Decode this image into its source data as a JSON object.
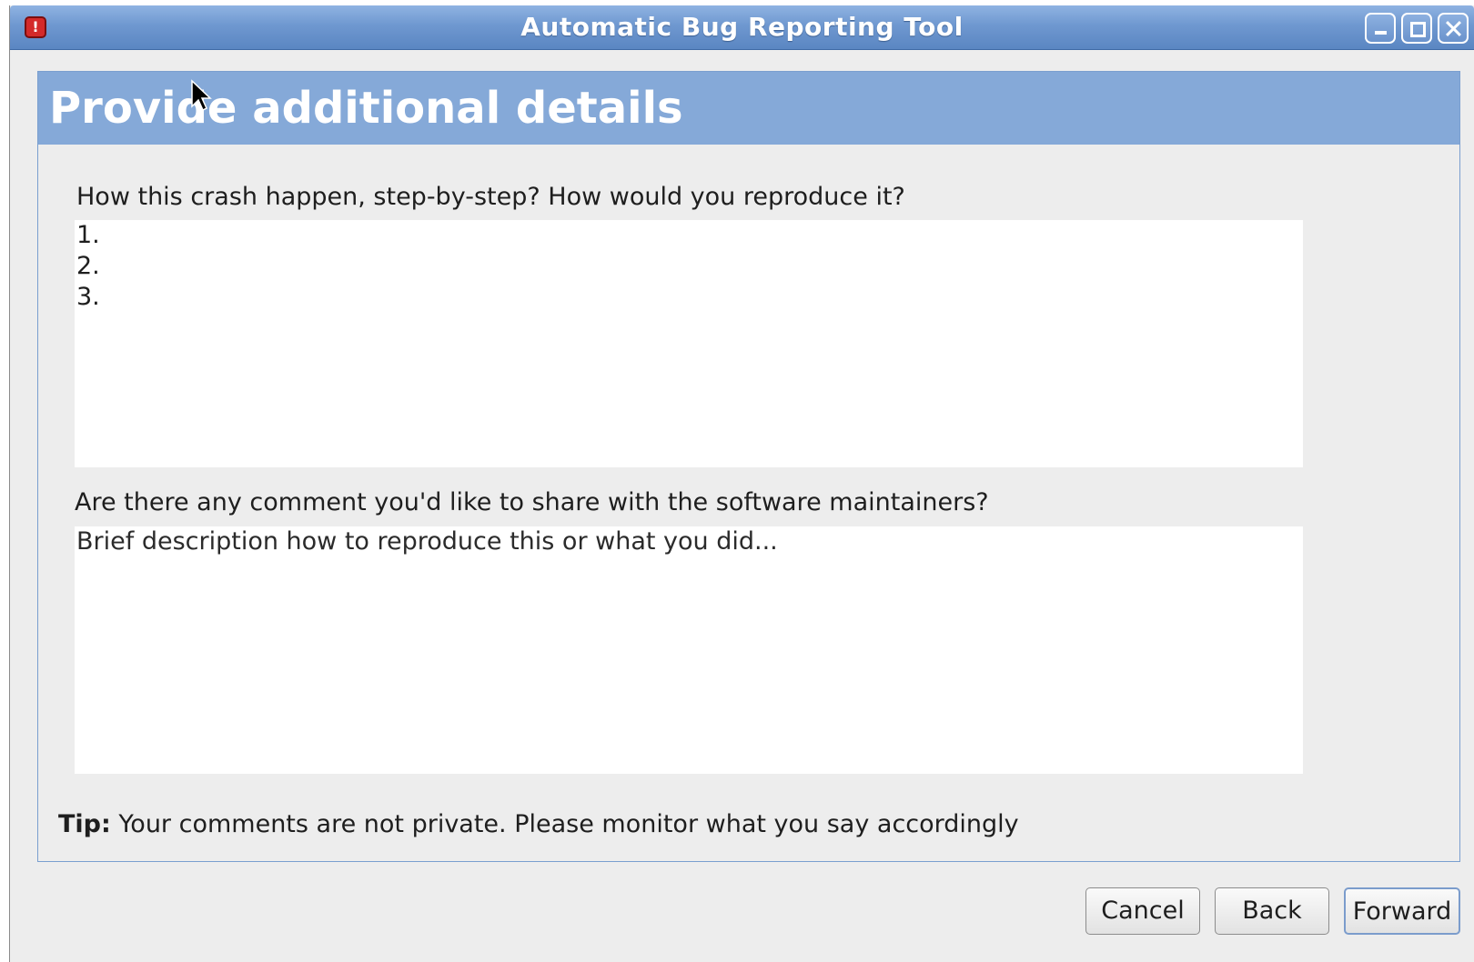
{
  "window": {
    "title": "Automatic Bug Reporting Tool",
    "icon": "abrt-alert-icon"
  },
  "page": {
    "title": "Provide additional details"
  },
  "steps": {
    "label": "How this crash happen, step-by-step? How would you reproduce it?",
    "value": "1.\n2.\n3."
  },
  "comment": {
    "label": "Are there any comment you'd like to share with the software maintainers?",
    "placeholder": "Brief description how to reproduce this or what you did..."
  },
  "tip": {
    "strong": "Tip:",
    "text": "Your comments are not private. Please monitor what you say accordingly"
  },
  "buttons": {
    "cancel": "Cancel",
    "back": "Back",
    "forward": "Forward"
  },
  "colors": {
    "titlebar": "#6f98d0",
    "header": "#85a9d8",
    "background": "#ededed"
  }
}
